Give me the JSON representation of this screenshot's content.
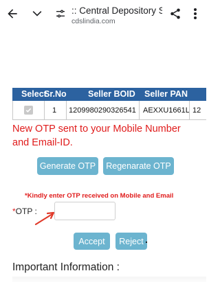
{
  "browser": {
    "title": ":: Central Depository S...",
    "url": "cdslindia.com",
    "icons": [
      "back-arrow-icon",
      "chevron-down-icon",
      "site-settings-icon",
      "share-icon",
      "more-vert-icon"
    ]
  },
  "table": {
    "headers": [
      "Select",
      "Sr.No",
      "Seller BOID",
      "Seller PAN"
    ],
    "rows": [
      {
        "sr_no": "1",
        "seller_boid": "1209980290326541",
        "seller_pan": "AEXXU1661L",
        "extra": "12"
      }
    ],
    "header_color": "#2c62a0"
  },
  "otp_message": "New OTP sent to your Mobile Number and Email-ID.",
  "buttons": {
    "generate": "Generate OTP",
    "regenerate": "Regenarate OTP",
    "accept": "Accept",
    "reject": "Reject"
  },
  "otp_note": "*Kindly enter OTP received on Mobile and Email",
  "otp_field": {
    "label_star": "*",
    "label": "OTP :",
    "value": ""
  },
  "important_heading": "Important Information :",
  "colors": {
    "accent_red": "#e01b1b",
    "button_blue": "#6cb4cf"
  }
}
